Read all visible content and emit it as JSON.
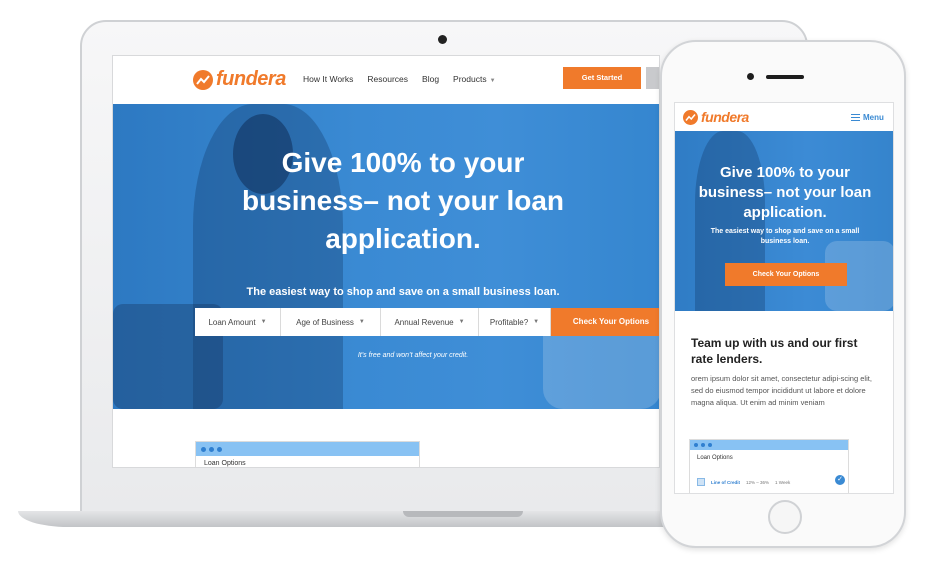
{
  "brand": {
    "name": "fundera",
    "accent": "#f07a2b",
    "hero_blue": "#3a8ad3"
  },
  "desktop": {
    "nav": {
      "links": [
        "How It Works",
        "Resources",
        "Blog",
        "Products"
      ],
      "cta": "Get Started"
    },
    "hero": {
      "headline": "Give 100% to your business– not your loan application.",
      "subhead": "The easiest way to shop and save on a small business loan.",
      "fields": [
        "Loan Amount",
        "Age of Business",
        "Annual Revenue",
        "Profitable?"
      ],
      "cta": "Check Your Options",
      "note": "It’s free and won’t affect your credit."
    },
    "card": {
      "label": "Loan Options"
    }
  },
  "mobile": {
    "menu_label": "Menu",
    "hero": {
      "headline": "Give 100% to your business– not your loan application.",
      "subhead": "The easiest way to shop and save on a small business loan.",
      "cta": "Check Your Options"
    },
    "section_title": "Team up with us and our first rate lenders.",
    "body": "orem ipsum dolor sit amet, consectetur adipi-scing elit, sed do eiusmod tempor incididunt ut labore et dolore magna aliqua. Ut enim ad minim veniam",
    "card": {
      "label": "Loan Options",
      "row": {
        "product": "Line of Credit",
        "rate": "12% – 36%",
        "time": "1 Week"
      }
    }
  },
  "icons": [
    "fundera-logo-icon",
    "chevron-down-icon",
    "hamburger-icon",
    "check-icon",
    "camera-icon",
    "home-button-icon"
  ]
}
